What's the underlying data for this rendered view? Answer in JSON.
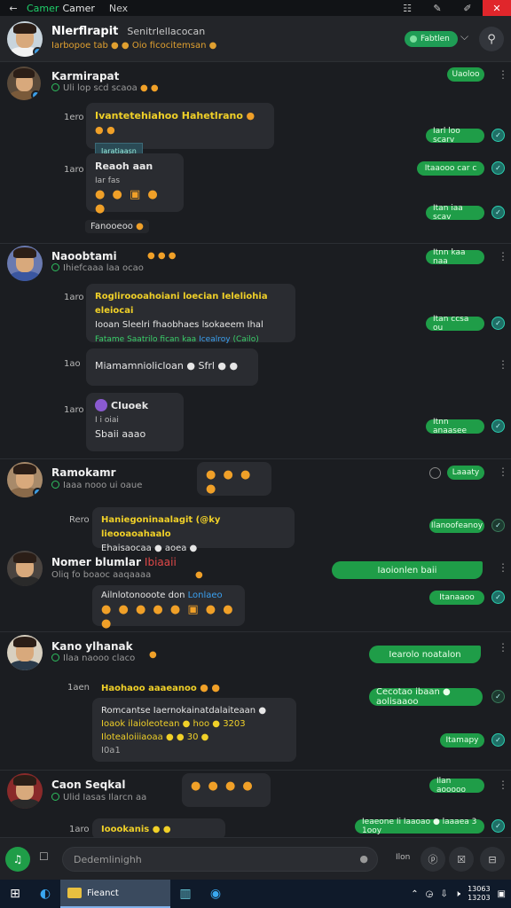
{
  "titlebar": {
    "back": "←",
    "app1": "Camer",
    "app2": "Camer",
    "menu": "Nex",
    "btn1": "☷",
    "btn2": "✎",
    "btn3": "✐",
    "close": "✕"
  },
  "header": {
    "name": "Nlerflrapit",
    "subtitle": "Senitrlellacocan",
    "status": "Iarbopoe tab  ● ● Oio ficocitemsan ●",
    "pill": "Fabtlen",
    "chev": "⌵",
    "action": "⚲"
  },
  "feed": {
    "u1": {
      "name": "Karmirapat",
      "meta": "Uli lop scd scaoa",
      "emo": "● ●"
    },
    "t1": "1ero",
    "m1_text": "Ivantetehiahoo  Hahetlrano",
    "m1_emo": "● ● ●",
    "m1_tag": "Iaratiaasn",
    "t2": "1aro",
    "m2_title": "Reaoh aan",
    "m2_sub": "Iar fas",
    "m2_emojis": "● ● ▣ ● ●",
    "chip1": "Fanooeoo",
    "p1": "Uaoloo",
    "p2": "Iarl loo scarv",
    "p3": "Itaaooo car c",
    "p4": "Itan iaa scav",
    "u2": {
      "name": "Naoobtami",
      "meta": "Ihiefcaaa laa ocao",
      "emo": "● ● ●"
    },
    "t3": "1aro",
    "m3_line1": "Rogliroooahoiani loecian  Ieleliohia eleiocai",
    "m3_line2": "Iooan  Sleelri  fhaobhaes  lsokaeem  Ihal",
    "m3_line3a": "Fatame  Saatrilo  fican  kaa",
    "m3_line3b": "Icealroy",
    "m3_line3c": "(Cailo)",
    "p5": "Itnn kaa naa",
    "p6": "Itan ccsa ou",
    "t4": "1ao",
    "m4_text": "Miamamniolicloan  ●  Sfrl  ● ●",
    "t5": "1aro",
    "m5_title": "Cluoek",
    "m5_sub": "I i oiai",
    "m5_line": "Sbaii  aaao",
    "p7": "Itnn anaasee",
    "u3": {
      "name": "Ramokamr",
      "meta": "Iaaa nooo ui oaue",
      "emo": "● ● ● ●"
    },
    "p8": "Laaaty",
    "t6": "Rero",
    "m6_title": "Haniegoninaalagit (@ky lieooaoahaalo",
    "m6_sub": "Ehaisaocaa  ●  aoea ●",
    "p9": "Ilanoofeanoy",
    "u4": {
      "name": "Nomer blumlar",
      "tag": "Ibiaaii",
      "meta": "Oliq fo boaoc aaqaaaa",
      "emo": "●"
    },
    "p10": "Iaoionlen baii",
    "m7_title": "Ailnlotonooote don",
    "m7_title2": "Lonlaeo",
    "m7_emojis": "● ● ● ● ● ▣ ● ● ●",
    "p11": "Itanaaoo",
    "u5": {
      "name": "Kano ylhanak",
      "meta": "Ilaa naooo claco",
      "emo": "●"
    },
    "p12": "Iearolo noatalon",
    "t7": "1aen",
    "m8_title": "Haohaoo  aaaeanoo",
    "m8_emo": "● ● ● ●",
    "m8_line1": "Romcantse  Iaernokainatdalaiteaan  ●",
    "m8_line2": "Ioaok  ilaioleotean  ●  hoo  ●  3203",
    "m8_line3": "Ilotealoiiiaoaa  ●  ●  30  ●",
    "m8_line4": "I0a1",
    "p13": "Cecotao ibaan  ●  aolisaaoo",
    "p14": "Itamapy",
    "u6": {
      "name": "Caon Seqkal",
      "meta": "Ulid Iasas Ilarcn aa",
      "emo": "● ● ● ●"
    },
    "p15": "Ilan aooooo",
    "t8": "1aro",
    "m9_text": "Ioookanis  ● ●",
    "p16": "Ieaeone  Ii  Iaaoao  ●  laaaea  3  1ooy"
  },
  "composer": {
    "plus": "♫",
    "emoji": "☐",
    "placeholder": "Dedemlinighh",
    "mic": "●",
    "time": "Ilon",
    "gif": "ⓟ",
    "sticker": "☒",
    "more": "⊟"
  },
  "taskbar": {
    "win": "⊞",
    "edge": "◐",
    "active_label": "Fieanct",
    "store": "▥",
    "mail": "◉",
    "tray1": "⌃",
    "tray2": "◶",
    "tray3": "⇩",
    "tray4": "🕨",
    "clock_time": "13063",
    "clock_date": "13203",
    "notif": "▣"
  }
}
